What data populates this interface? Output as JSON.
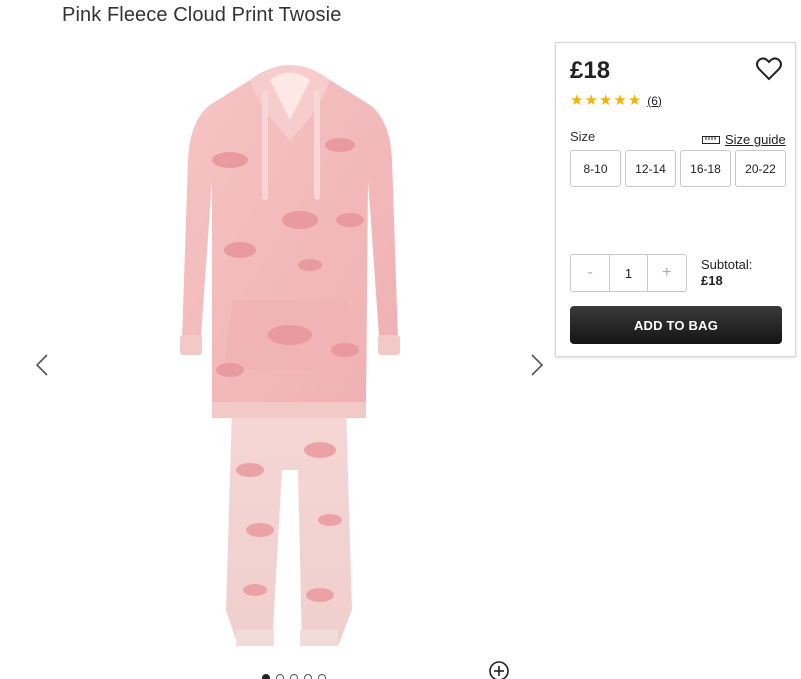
{
  "product": {
    "title": "Pink Fleece Cloud Print Twosie"
  },
  "gallery": {
    "prev_icon": "chevron-left-icon",
    "next_icon": "chevron-right-icon",
    "zoom_icon": "zoom-plus-icon",
    "dot_count": 5,
    "active_dot": 0
  },
  "purchase": {
    "price": "£18",
    "rating": 5,
    "review_count": "(6)",
    "size_label": "Size",
    "size_guide_label": "Size guide",
    "sizes": [
      "8-10",
      "12-14",
      "16-18",
      "20-22"
    ],
    "quantity": "1",
    "decrement_label": "-",
    "increment_label": "+",
    "subtotal_label": "Subtotal:",
    "subtotal_value": "£18",
    "add_to_bag_label": "ADD TO BAG"
  },
  "colors": {
    "accent_star": "#f5b400",
    "button_dark": "#151515",
    "garment_pink": "#f3b8ba"
  }
}
